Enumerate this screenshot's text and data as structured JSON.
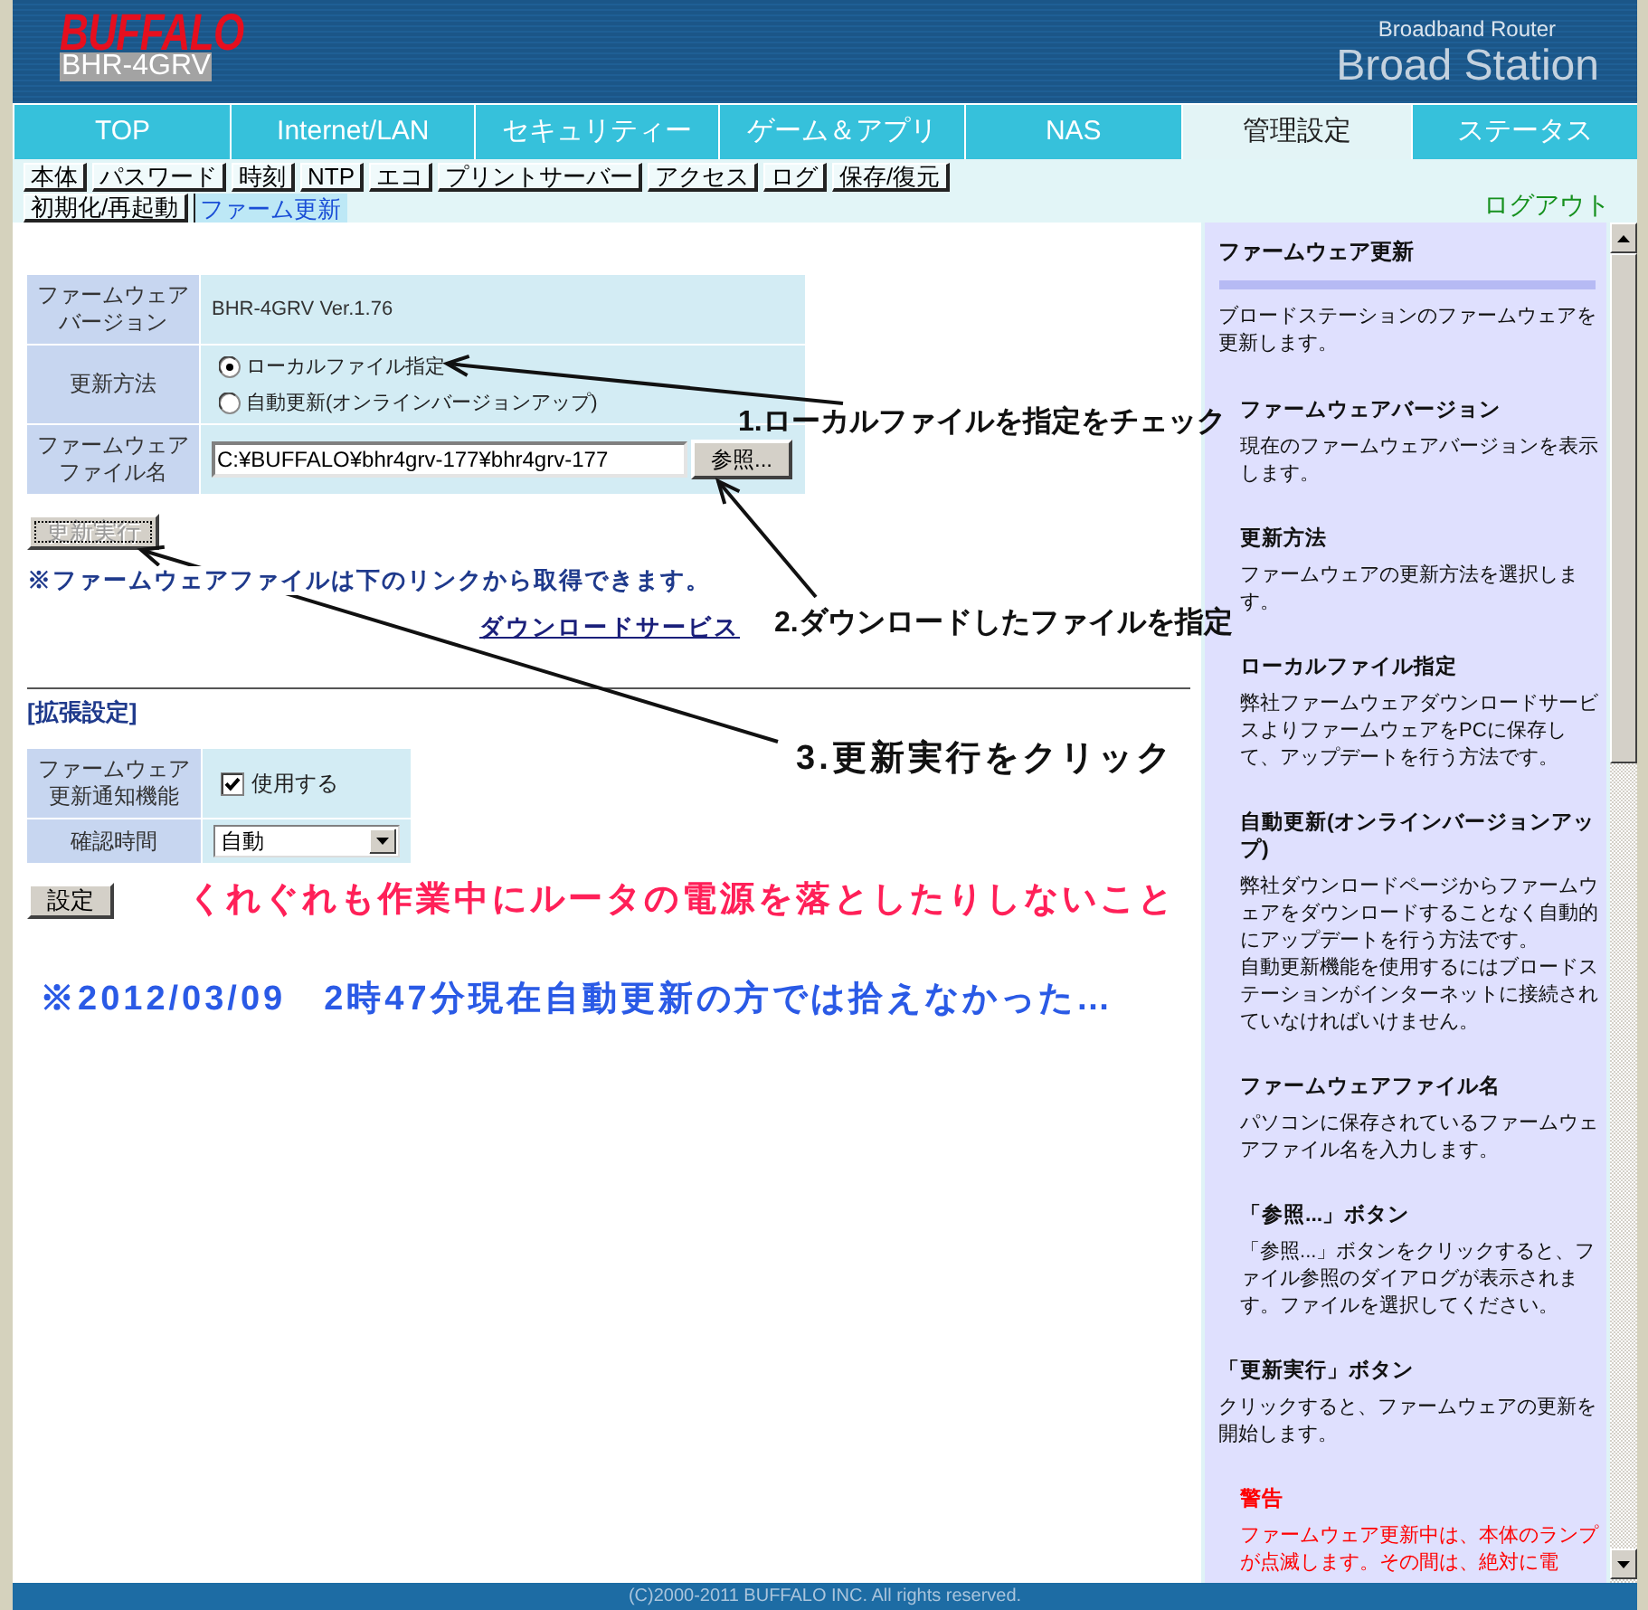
{
  "header": {
    "logo": "BUFFALO",
    "model": "BHR-4GRV",
    "product_type": "Broadband Router",
    "product_name": "Broad Station"
  },
  "tabs": [
    {
      "label": "TOP",
      "selected": false
    },
    {
      "label": "Internet/LAN",
      "selected": false
    },
    {
      "label": "セキュリティー",
      "selected": false
    },
    {
      "label": "ゲーム＆アプリ",
      "selected": false
    },
    {
      "label": "NAS",
      "selected": false
    },
    {
      "label": "管理設定",
      "selected": true
    },
    {
      "label": "ステータス",
      "selected": false
    }
  ],
  "subtab_rows": [
    [
      {
        "label": "本体",
        "selected": false
      },
      {
        "label": "パスワード",
        "selected": false
      },
      {
        "label": "時刻",
        "selected": false
      },
      {
        "label": "NTP",
        "selected": false
      },
      {
        "label": "エコ",
        "selected": false
      },
      {
        "label": "プリントサーバー",
        "selected": false
      },
      {
        "label": "アクセス",
        "selected": false
      },
      {
        "label": "ログ",
        "selected": false
      },
      {
        "label": "保存/復元",
        "selected": false
      }
    ],
    [
      {
        "label": "初期化/再起動",
        "selected": false
      },
      {
        "label": "ファーム更新",
        "selected": true
      }
    ]
  ],
  "logout": "ログアウト",
  "firmware_form": {
    "rows": [
      {
        "kind": "text",
        "label": "ファームウェアバージョン",
        "value": "BHR-4GRV Ver.1.76"
      },
      {
        "kind": "radio",
        "label": "更新方法",
        "options": [
          {
            "label": "ローカルファイル指定",
            "selected": true
          },
          {
            "label": "自動更新(オンラインバージョンアップ)",
            "selected": false
          }
        ]
      },
      {
        "kind": "file",
        "label": "ファームウェアファイル名",
        "value": "C:¥BUFFALO¥bhr4grv-177¥bhr4grv-177",
        "button": "参照..."
      }
    ],
    "update_button": {
      "label": "更新実行",
      "disabled": true
    },
    "note": "※ファームウェアファイルは下のリンクから取得できます。",
    "download_link": "ダウンロードサービス"
  },
  "advanced_settings": {
    "title": "[拡張設定]",
    "rows": [
      {
        "kind": "checkbox",
        "label": "ファームウェア更新通知機能",
        "option": "使用する",
        "checked": true
      },
      {
        "kind": "select",
        "label": "確認時間",
        "value": "自動"
      }
    ],
    "apply_button": "設定"
  },
  "notes": [
    {
      "text": "くれぐれも作業中にルータの電源を落としたりしないこと",
      "color": "#ff2058"
    },
    {
      "text": "※2012/03/09　2時47分現在自動更新の方では拾えなかった…",
      "color": "#2a5ae6"
    }
  ],
  "annotations": [
    "1.ローカルファイルを指定をチェック",
    "2.ダウンロードしたファイルを指定",
    "3.更新実行をクリック"
  ],
  "help": {
    "title": "ファームウェア更新",
    "intro": "ブロードステーションのファームウェアを更新します。",
    "items": [
      {
        "kind": "sub",
        "heading": "ファームウェアバージョン",
        "paragraphs": [
          "現在のファームウェアバージョンを表示します。"
        ]
      },
      {
        "kind": "sub",
        "heading": "更新方法",
        "paragraphs": [
          "ファームウェアの更新方法を選択します。"
        ]
      },
      {
        "kind": "sub",
        "heading": "ローカルファイル指定",
        "paragraphs": [
          "弊社ファームウェアダウンロードサービスよりファームウェアをPCに保存して、アップデートを行う方法です。"
        ]
      },
      {
        "kind": "sub",
        "heading": "自動更新(オンラインバージョンアップ)",
        "paragraphs": [
          "弊社ダウンロードページからファームウェアをダウンロードすることなく自動的にアップデートを行う方法です。",
          "自動更新機能を使用するにはブロードステーションがインターネットに接続されていなければいけません。"
        ]
      },
      {
        "kind": "sub",
        "heading": "ファームウェアファイル名",
        "paragraphs": [
          "パソコンに保存されているファームウェアファイル名を入力します。"
        ]
      },
      {
        "kind": "sub",
        "heading": "「参照...」ボタン",
        "paragraphs": [
          "「参照...」ボタンをクリックすると、ファイル参照のダイアログが表示されます。ファイルを選択してください。"
        ]
      },
      {
        "kind": "main",
        "heading": "「更新実行」ボタン",
        "paragraphs": [
          "クリックすると、ファームウェアの更新を開始します。"
        ]
      },
      {
        "kind": "warning",
        "heading": "警告",
        "paragraphs": [
          "ファームウェア更新中は、本体のランプが点滅します。その間は、絶対に電"
        ]
      }
    ]
  },
  "footer": "(C)2000-2011 BUFFALO INC. All rights reserved."
}
